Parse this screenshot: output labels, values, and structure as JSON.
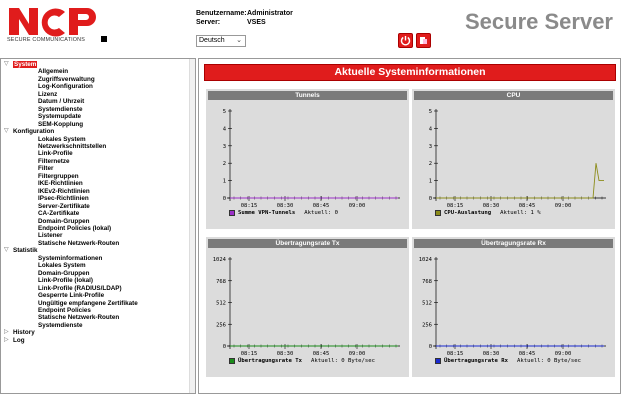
{
  "header": {
    "logo_sub": "SECURE COMMUNICATIONS",
    "username_label": "Benutzername:",
    "username_value": "Administrator",
    "server_label": "Server:",
    "server_value": "VSES",
    "language": "Deutsch",
    "product_title": "Secure Server",
    "logout_icon": "power-icon",
    "help_icon": "help-icon"
  },
  "nav": {
    "system": "System",
    "system_items": [
      "Allgemein",
      "Zugriffsverwaltung",
      "Log-Konfiguration",
      "Lizenz",
      "Datum / Uhrzeit",
      "Systemdienste",
      "Systemupdate",
      "SEM-Kopplung"
    ],
    "konfiguration": "Konfiguration",
    "konfiguration_items": [
      "Lokales System",
      "Netzwerkschnittstellen",
      "Link-Profile",
      "Filternetze",
      "Filter",
      "Filtergruppen",
      "IKE-Richtlinien",
      "IKEv2-Richtlinien",
      "IPsec-Richtlinien",
      "Server-Zertifikate",
      "CA-Zertifikate",
      "Domain-Gruppen",
      "Endpoint Policies (lokal)",
      "Listener",
      "Statische Netzwerk-Routen"
    ],
    "statistik": "Statistik",
    "statistik_items": [
      "Systeminformationen",
      "Lokales System",
      "Domain-Gruppen",
      "Link-Profile (lokal)",
      "Link-Profile (RADIUS/LDAP)",
      "Gesperrte Link-Profile",
      "Ungültige empfangene Zertifikate",
      "Endpoint Policies",
      "Statische Netzwerk-Routen",
      "Systemdienste"
    ],
    "history": "History",
    "log": "Log"
  },
  "content": {
    "banner": "Aktuelle Systeminformationen"
  },
  "chart_data": [
    {
      "type": "line",
      "title": "Tunnels",
      "x": [
        "08:15",
        "08:30",
        "08:45",
        "09:00"
      ],
      "ylim": [
        0,
        5
      ],
      "yticks": [
        "0",
        "1",
        "2",
        "3",
        "4",
        "5"
      ],
      "series": [
        {
          "name": "Summe VPN-Tunnels",
          "color": "#9b30c8",
          "values": [
            0,
            0,
            0,
            0
          ]
        }
      ],
      "legend_current": "Aktuell: 0"
    },
    {
      "type": "line",
      "title": "CPU",
      "x": [
        "08:15",
        "08:30",
        "08:45",
        "09:00"
      ],
      "ylim": [
        0,
        5
      ],
      "yticks": [
        "0",
        "1",
        "2",
        "3",
        "4",
        "5"
      ],
      "series": [
        {
          "name": "CPU-Auslastung",
          "color": "#8c8c1a",
          "values": [
            0,
            0,
            0,
            0,
            0,
            2,
            1
          ]
        }
      ],
      "legend_current": "Aktuell: 1 %"
    },
    {
      "type": "line",
      "title": "Übertragungsrate Tx",
      "x": [
        "08:15",
        "08:30",
        "08:45",
        "09:00"
      ],
      "ylim": [
        0,
        1024
      ],
      "yticks": [
        "0",
        "256",
        "512",
        "768",
        "1024"
      ],
      "series": [
        {
          "name": "Übertragungsrate Tx",
          "color": "#1a8c1a",
          "values": [
            0,
            0,
            0,
            0
          ]
        }
      ],
      "legend_current": "Aktuell: 0 Byte/sec"
    },
    {
      "type": "line",
      "title": "Übertragungsrate Rx",
      "x": [
        "08:15",
        "08:30",
        "08:45",
        "09:00"
      ],
      "ylim": [
        0,
        1024
      ],
      "yticks": [
        "0",
        "256",
        "512",
        "768",
        "1024"
      ],
      "series": [
        {
          "name": "Übertragungsrate Rx",
          "color": "#1a2ad0",
          "values": [
            0,
            0,
            0,
            0
          ]
        }
      ],
      "legend_current": "Aktuell: 0 Byte/sec"
    }
  ]
}
